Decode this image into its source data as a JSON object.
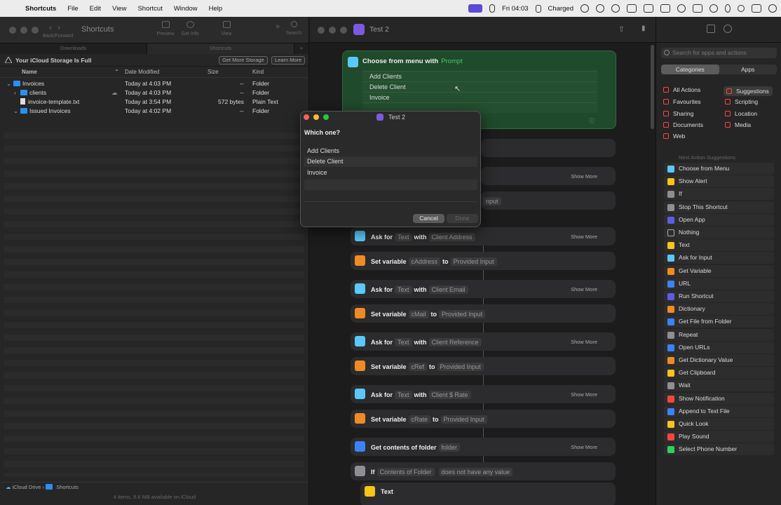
{
  "menubar": {
    "app": "Shortcuts",
    "items": [
      "File",
      "Edit",
      "View",
      "Shortcut",
      "Window",
      "Help"
    ],
    "clock": "Fri 04:03",
    "battery": "Charged"
  },
  "finder": {
    "title": "Shortcuts",
    "nav_label": "Back/Forward",
    "tools": [
      "Preview",
      "Get Info",
      "View",
      "Search"
    ],
    "tabs": [
      "Downloads",
      "Shortcuts"
    ],
    "banner": {
      "text": "Your iCloud Storage Is Full",
      "btn_get": "Get More Storage",
      "btn_learn": "Learn More"
    },
    "columns": [
      "Name",
      "Date Modified",
      "Size",
      "Kind"
    ],
    "rows": [
      {
        "name": "Invoices",
        "date": "Today at 4:03 PM",
        "size": "--",
        "kind": "Folder"
      },
      {
        "name": "clients",
        "date": "Today at 4:03 PM",
        "size": "--",
        "kind": "Folder"
      },
      {
        "name": "invoice-template.txt",
        "date": "Today at 3:54 PM",
        "size": "572 bytes",
        "kind": "Plain Text"
      },
      {
        "name": "Issued Invoices",
        "date": "Today at 4:02 PM",
        "size": "--",
        "kind": "Folder"
      }
    ],
    "path": [
      "iCloud Drive",
      "Shortcuts"
    ],
    "status": "4 items, 9.6 MB available on iCloud"
  },
  "editor": {
    "title": "Test 2",
    "choose": {
      "label": "Choose from menu with",
      "prompt": "Prompt",
      "options": [
        "Add Clients",
        "Delete Client",
        "Invoice"
      ]
    },
    "show_more": "Show More",
    "actions": [
      {
        "a": "Ask for",
        "b": "Text",
        "c": "with",
        "d": "Client Address",
        "more": true
      },
      {
        "a": "Set variable",
        "b": "cAddress",
        "c": "to",
        "d": "Provided Input",
        "more": false
      },
      {
        "a": "Ask for",
        "b": "Text",
        "c": "with",
        "d": "Client Email",
        "more": true
      },
      {
        "a": "Set variable",
        "b": "cMail",
        "c": "to",
        "d": "Provided Input",
        "more": false
      },
      {
        "a": "Ask for",
        "b": "Text",
        "c": "with",
        "d": "Client Reference",
        "more": true
      },
      {
        "a": "Set variable",
        "b": "cRef",
        "c": "to",
        "d": "Provided Input",
        "more": false
      },
      {
        "a": "Ask for",
        "b": "Text",
        "c": "with",
        "d": "Client $ Rate",
        "more": true
      },
      {
        "a": "Set variable",
        "b": "cRate",
        "c": "to",
        "d": "Provided Input",
        "more": false
      },
      {
        "a": "Get contents of folder",
        "b": "folder",
        "c": "",
        "d": "",
        "more": true
      },
      {
        "a": "If",
        "b": "Contents of Folder",
        "c": "",
        "d": "does not have any value",
        "more": false
      }
    ],
    "partial_input": "nput",
    "text_action": "Text",
    "colors": {
      "ask": "#5ac8fa",
      "var": "#f08a24",
      "folder": "#3b82f6",
      "if": "#8e8e93",
      "text": "#f5c518"
    }
  },
  "dialog": {
    "title": "Test 2",
    "question": "Which one?",
    "options": [
      "Add Clients",
      "Delete Client",
      "Invoice"
    ],
    "cancel": "Cancel",
    "done": "Done"
  },
  "library": {
    "search_placeholder": "Search for apps and actions",
    "segments": [
      "Categories",
      "Apps"
    ],
    "categories": [
      {
        "label": "All Actions",
        "color": "#ff453a"
      },
      {
        "label": "Suggestions",
        "color": "#ff453a"
      },
      {
        "label": "Favourites",
        "color": "#ff453a"
      },
      {
        "label": "Scripting",
        "color": "#ff453a"
      },
      {
        "label": "Sharing",
        "color": "#ff453a"
      },
      {
        "label": "Location",
        "color": "#ff453a"
      },
      {
        "label": "Documents",
        "color": "#ff453a"
      },
      {
        "label": "Media",
        "color": "#ff453a"
      },
      {
        "label": "Web",
        "color": "#ff453a"
      }
    ],
    "next_heading": "Next Action Suggestions",
    "suggestions": [
      {
        "label": "Choose from Menu",
        "color": "#5ac8fa"
      },
      {
        "label": "Show Alert",
        "color": "#f5c518"
      },
      {
        "label": "If",
        "color": "#8e8e93"
      },
      {
        "label": "Stop This Shortcut",
        "color": "#8e8e93"
      },
      {
        "label": "Open App",
        "color": "#5e5ce6"
      },
      {
        "label": "Nothing",
        "color": "#2d2d2d"
      },
      {
        "label": "Text",
        "color": "#f5c518"
      },
      {
        "label": "Ask for Input",
        "color": "#5ac8fa"
      },
      {
        "label": "Get Variable",
        "color": "#f08a24"
      },
      {
        "label": "URL",
        "color": "#3b82f6"
      },
      {
        "label": "Run Shortcut",
        "color": "#5e5ce6"
      },
      {
        "label": "Dictionary",
        "color": "#f08a24"
      },
      {
        "label": "Get File from Folder",
        "color": "#3b82f6"
      },
      {
        "label": "Repeat",
        "color": "#8e8e93"
      },
      {
        "label": "Open URLs",
        "color": "#3b82f6"
      },
      {
        "label": "Get Dictionary Value",
        "color": "#f08a24"
      },
      {
        "label": "Get Clipboard",
        "color": "#f5c518"
      },
      {
        "label": "Wait",
        "color": "#8e8e93"
      },
      {
        "label": "Show Notification",
        "color": "#ff453a"
      },
      {
        "label": "Append to Text File",
        "color": "#3b82f6"
      },
      {
        "label": "Quick Look",
        "color": "#f5c518"
      },
      {
        "label": "Play Sound",
        "color": "#ff453a"
      },
      {
        "label": "Select Phone Number",
        "color": "#30d158"
      }
    ]
  }
}
